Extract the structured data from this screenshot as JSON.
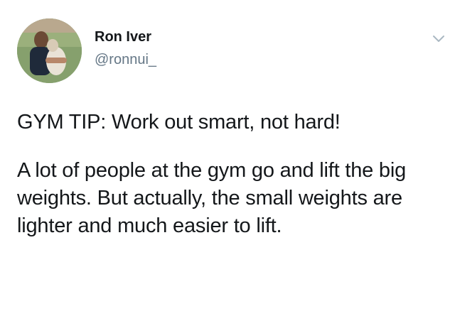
{
  "author": {
    "display_name": "Ron Iver",
    "handle": "@ronnui_"
  },
  "tweet": {
    "line1": "GYM TIP: Work out smart, not hard!",
    "body": "A lot of people at the gym go and lift the big weights. But actually, the small weights are lighter and much easier to lift."
  },
  "icons": {
    "menu": "chevron-down-icon",
    "avatar": "profile-photo"
  },
  "colors": {
    "text": "#14171a",
    "secondary": "#657786",
    "chevron": "#aab8c2"
  }
}
